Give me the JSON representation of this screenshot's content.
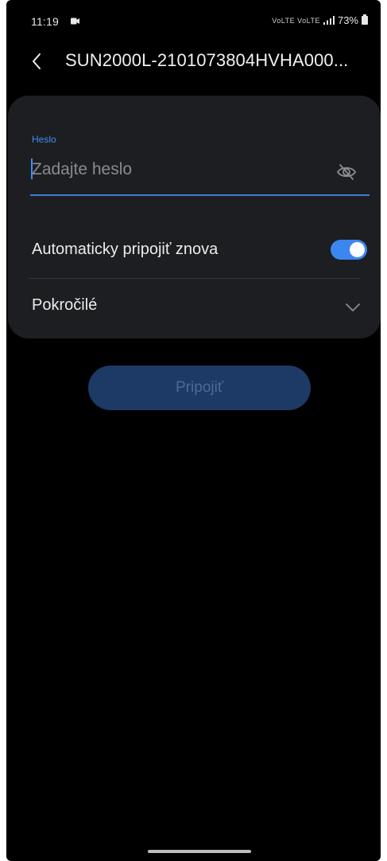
{
  "status_bar": {
    "time": "11:19",
    "network_text": "VoLTE VoLTE",
    "battery": "73%",
    "icons": [
      "video-record-icon",
      "signal-icon",
      "battery-icon"
    ]
  },
  "header": {
    "title": "SUN2000L-2101073804HVHA000..."
  },
  "form": {
    "password_label": "Heslo",
    "password_placeholder": "Zadajte heslo",
    "password_value": "",
    "autoconnect_label": "Automaticky pripojiť znova",
    "autoconnect_enabled": true,
    "advanced_label": "Pokročilé"
  },
  "actions": {
    "connect_label": "Pripojiť"
  },
  "colors": {
    "accent": "#3c86f0",
    "card_background": "#1d1e21",
    "button_disabled": "#1d3a66"
  }
}
